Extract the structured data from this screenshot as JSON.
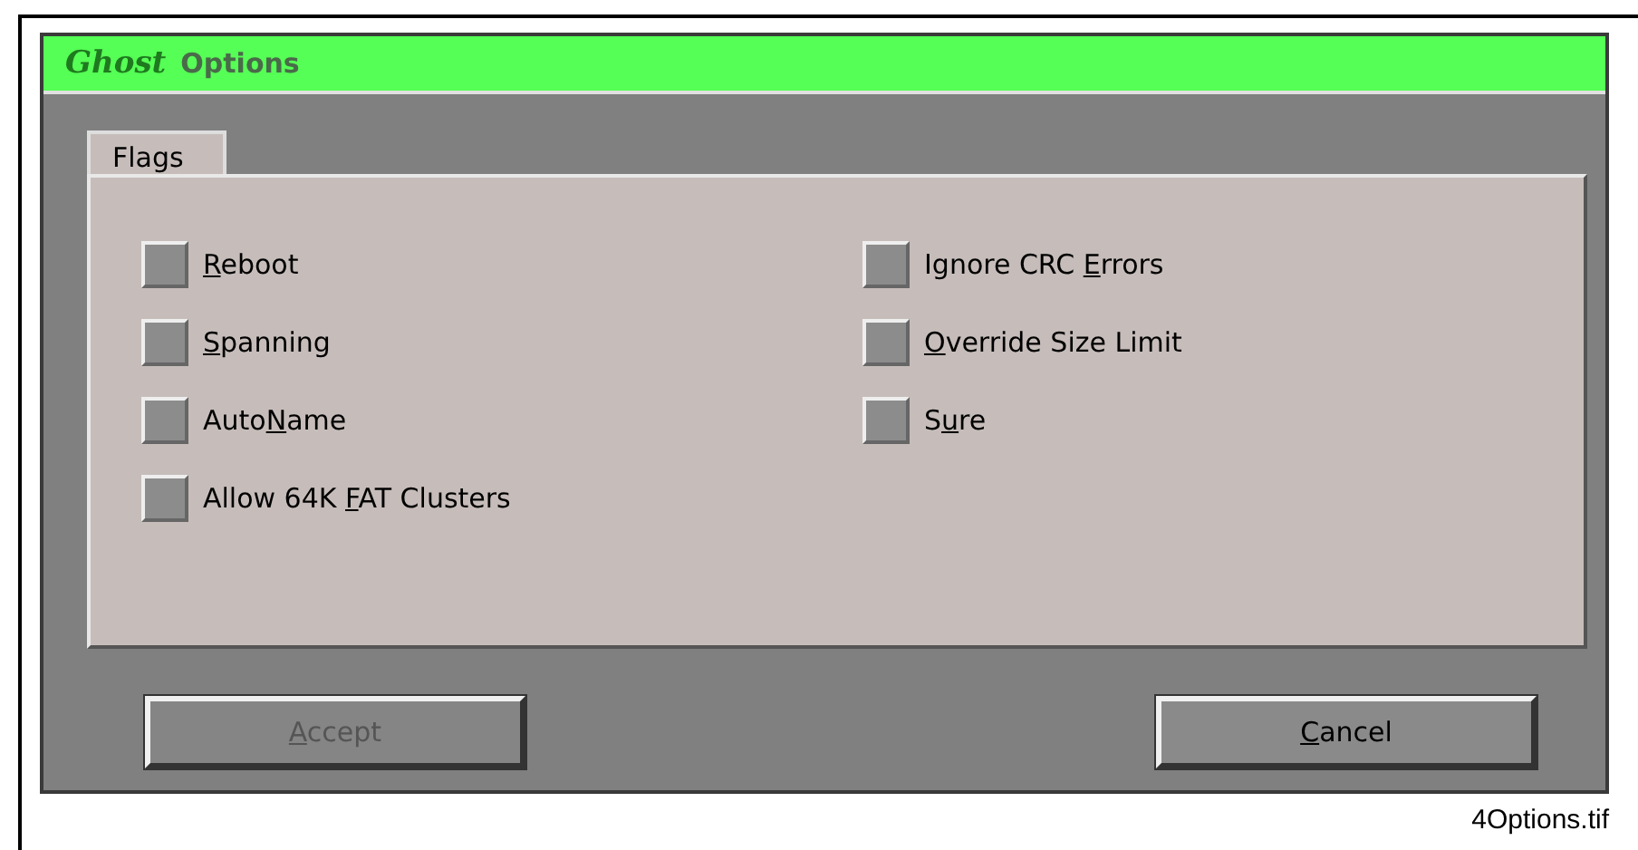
{
  "window": {
    "logo": "Ghost",
    "title": "Options"
  },
  "tabs": [
    {
      "label": "Flags",
      "selected": true
    }
  ],
  "flags": [
    {
      "hotkey": "R",
      "after": "eboot",
      "checked": false
    },
    {
      "hotkey": "S",
      "after": "panning",
      "checked": false
    },
    {
      "before": "Auto",
      "hotkey": "N",
      "after": "ame",
      "checked": false
    },
    {
      "before": "Allow 64K ",
      "hotkey": "F",
      "after": "AT Clusters",
      "checked": false
    },
    {
      "before": "Ignore CRC ",
      "hotkey": "E",
      "after": "rrors",
      "checked": false
    },
    {
      "hotkey": "O",
      "after": "verride Size Limit",
      "checked": false
    },
    {
      "before": "S",
      "hotkey": "u",
      "after": "re",
      "checked": false
    }
  ],
  "buttons": [
    {
      "hotkey": "A",
      "after": "ccept",
      "disabled": true
    },
    {
      "hotkey": "C",
      "after": "ancel",
      "disabled": false
    }
  ],
  "caption": "4Options.tif"
}
